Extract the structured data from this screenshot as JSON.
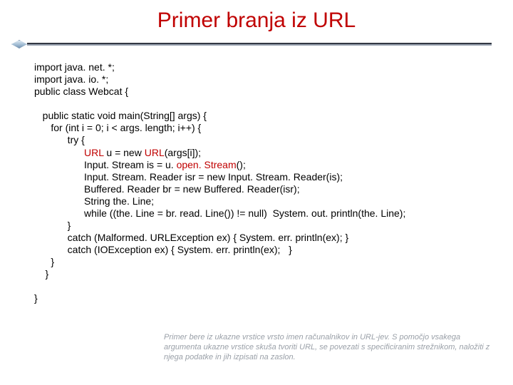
{
  "title": "Primer branja iz URL",
  "code": {
    "l1": "import java. net. *;",
    "l2": "import java. io. *;",
    "l3": "public class Webcat {",
    "l4": "",
    "l5": "   public static void main(String[] args) {",
    "l6": "      for (int i = 0; i < args. length; i++) {",
    "l7": "            try {",
    "l8a": "                  ",
    "l8b": "URL",
    "l8c": " u = new ",
    "l8d": "URL",
    "l8e": "(args[i]);",
    "l9a": "                  Input. Stream is = u. ",
    "l9b": "open. Stream",
    "l9c": "();",
    "l10": "                  Input. Stream. Reader isr = new Input. Stream. Reader(is);",
    "l11": "                  Buffered. Reader br = new Buffered. Reader(isr);",
    "l12": "                  String the. Line;",
    "l13": "                  while ((the. Line = br. read. Line()) != null)  System. out. println(the. Line);",
    "l14": "            }",
    "l15": "            catch (Malformed. URLException ex) { System. err. println(ex); }",
    "l16": "            catch (IOException ex) { System. err. println(ex);   }",
    "l17": "      }",
    "l18": "    }",
    "l19": "",
    "l20": "}"
  },
  "note": "Primer bere iz ukazne vrstice vrsto imen računalnikov in URL-jev.  S pomočjo vsakega argumenta ukazne vrstice skuša tvoriti URL, se povezati s specificiranim strežnikom, naložiti z njega podatke in jih izpisati na zaslon."
}
